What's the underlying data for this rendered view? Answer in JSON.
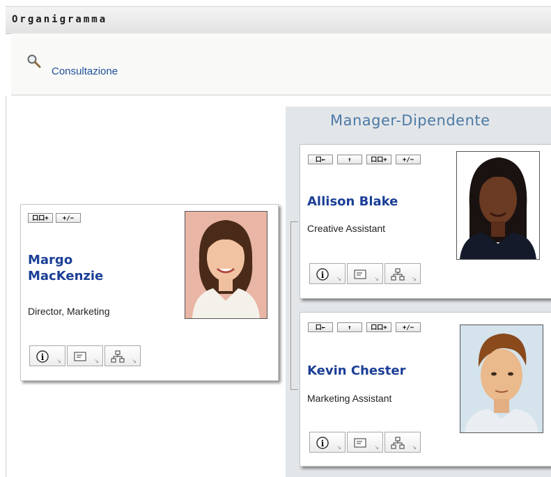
{
  "window": {
    "title": "Organigramma"
  },
  "toolbar": {
    "search_icon": "search-icon",
    "search_link": "Consultazione"
  },
  "chart": {
    "title": "Manager-Dipendente",
    "manager": {
      "name_line1": "Margo",
      "name_line2": "MacKenzie",
      "title": "Director, Marketing",
      "controls": [
        "口口+",
        "+/−"
      ]
    },
    "reports": [
      {
        "name": "Allison Blake",
        "title": "Creative Assistant",
        "controls": [
          "口←",
          "↑",
          "口口+",
          "+/−"
        ]
      },
      {
        "name": "Kevin Chester",
        "title": "Marketing Assistant",
        "controls": [
          "口←",
          "↑",
          "口口+",
          "+/−"
        ]
      }
    ]
  },
  "icons": {
    "info": "info-icon",
    "card": "vcard-icon",
    "org": "org-chart-icon"
  }
}
